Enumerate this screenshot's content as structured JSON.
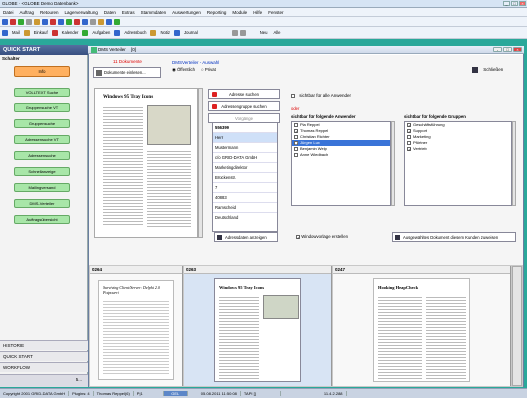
{
  "app": {
    "title": "GLOBE · <GLOBE Demo Datenbank>"
  },
  "menu": [
    "Datei",
    "Auftrag",
    "Retouren",
    "Lagerverwaltung",
    "Daten",
    "Extras",
    "Stammdaten",
    "Auswertungen",
    "Reporting",
    "Module",
    "Hilfe",
    "Fenster"
  ],
  "toolbar2": [
    "Mail",
    "Einkauf",
    "Kalender",
    "Aufgaben",
    "Adressbuch",
    "Notiz",
    "Journal",
    "Neu",
    "Alle"
  ],
  "sidebar": {
    "header": "QUICK START",
    "section": "Schalter",
    "info": "Info",
    "buttons": [
      "VOLLTEXT Suche",
      "Gruppensuche VT",
      "Gruppensuche",
      "Adressensuche VT",
      "Adressensuche",
      "Schnellanzeige",
      "Mailingversand",
      "DMS-Verteiler",
      "Auftragsübersicht"
    ],
    "tabs": [
      "HISTORIE",
      "QUICK START",
      "WORKFLOW"
    ],
    "page": "5..."
  },
  "window": {
    "title": "DMS Verteiler",
    "id": "[0]"
  },
  "dialog": {
    "doc_count": "11 Dokumente",
    "auswahl_label": "DMSVerteiler - Auswahl",
    "radio_public": "Öffentlich",
    "radio_private": "Privat",
    "docs_button": "Dokumente einlesen...",
    "close_button": "Schließen",
    "addr_search": "Adresse suchen",
    "group_search": "Adressengruppe suchen",
    "history": "Vorgänge",
    "check_all": "sichtbar für alle Anwender",
    "or_label": "oder",
    "users_label": "sichtbar für folgende Anwender",
    "groups_label": "sichtbar für folgende Gruppen",
    "show_addr": "Adressdaten anzeigen",
    "preview_window": "Windowvorlage erstellen",
    "assign": "Ausgewähltes Dokument diesem Kunden zuweisen",
    "preview_title": "Windows 95 Tray Icons"
  },
  "address": [
    "556399",
    "Herr",
    "Mustermann",
    "c/o GRID-DATA GmbH",
    "Marketingdirektor",
    "Brückenstr.",
    "7",
    "40883",
    "Ramscheid",
    "Deutschland"
  ],
  "users": [
    {
      "name": "Pia Reppel",
      "checked": false
    },
    {
      "name": "Thomas Reppel",
      "checked": true
    },
    {
      "name": "Christian Richter",
      "checked": false
    },
    {
      "name": "Jürgen Lux",
      "checked": true,
      "selected": true
    },
    {
      "name": "Benjamin Welp",
      "checked": false
    },
    {
      "name": "Anne Wiedbach",
      "checked": false
    }
  ],
  "groups": [
    {
      "name": "Geschäftsführung",
      "checked": true
    },
    {
      "name": "Support",
      "checked": true
    },
    {
      "name": "Marketing",
      "checked": false
    },
    {
      "name": "Pförtner",
      "checked": false
    },
    {
      "name": "Vertrieb",
      "checked": true
    }
  ],
  "thumbnails": [
    {
      "id": "0264",
      "title": ""
    },
    {
      "id": "0263",
      "title": "Surviving Client/Server: Delphi 2.0 Potpourri"
    },
    {
      "id": "0247",
      "title": "Windows 95 Tray Icons"
    },
    {
      "id": "",
      "title": "Hooking HeapCheck"
    }
  ],
  "status": {
    "copyright": "Copyright 2001 GRID-DATA GmbH",
    "plugins": "Plugins: 4",
    "user": "Thomas Reppel(6)",
    "mode": "P|1",
    "field": "GEL",
    "date": "05.08.2011 11:50:08",
    "tap": "TAPI []",
    "day": "11.4.2.288"
  },
  "colors": {
    "accent": "#3a74d8",
    "teal_bg": "#2aa89a",
    "info": "#ffb060",
    "green": "#a8e6a8"
  }
}
